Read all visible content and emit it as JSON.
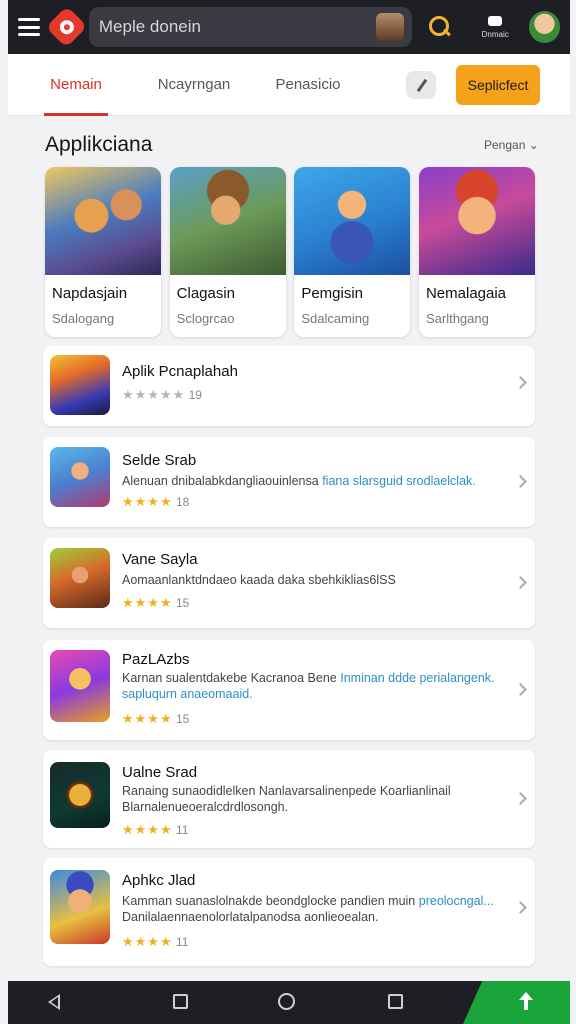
{
  "topbar": {
    "search_text": "Meple donein",
    "profile_label": "Dnmaic"
  },
  "tabs": [
    {
      "label": "Nemain",
      "active": true
    },
    {
      "label": "Ncayrngan",
      "active": false
    },
    {
      "label": "Penasicio",
      "active": false
    }
  ],
  "cta_label": "Seplicfect",
  "section": {
    "title": "Applikciana",
    "sort_label": "Pengan ⌄"
  },
  "featured": [
    {
      "name": "Napdasjain",
      "sub": "Sdalogang",
      "icon": "game-art-warriors"
    },
    {
      "name": "Clagasin",
      "sub": "Sclogrcao",
      "icon": "game-art-cowboy"
    },
    {
      "name": "Pemgisin",
      "sub": "Sdalcaming",
      "icon": "game-art-pirate"
    },
    {
      "name": "Nemalagaia",
      "sub": "Sarlthgang",
      "icon": "game-art-hero"
    }
  ],
  "apps": [
    {
      "title": "Aplik Pcnaplahah",
      "desc": "",
      "desc_hl": "",
      "desc2": "",
      "rating": "19",
      "stars": "★★★★★",
      "grey": true,
      "icon": "game-icon-arcade"
    },
    {
      "title": "Selde Srab",
      "desc": "Alenuan dnibalabkdangliaouinlensa",
      "desc_hl": "fiana slarsguid srodlaelclak.",
      "desc2": "",
      "rating": "18",
      "stars": "★★★★",
      "grey": false,
      "icon": "game-icon-archer"
    },
    {
      "title": "Vane Sayla",
      "desc": "Aomaanlanktdndaeo kaada daka sbehkiklias6lSS",
      "desc_hl": "",
      "desc2": "",
      "rating": "15",
      "stars": "★★★★",
      "grey": false,
      "icon": "game-icon-racer"
    },
    {
      "title": "PazLAzbs",
      "desc": "Karnan sualentdakebe Kacranoa Bene",
      "desc_hl": "Inminan ddde perialangenk.",
      "desc2": "sapluqurn anaeomaaid.",
      "rating": "15",
      "stars": "★★★★",
      "grey": false,
      "icon": "game-icon-royal"
    },
    {
      "title": "Ualne Srad",
      "desc": "Ranaing sunaodidlelken Nanlavarsalinenpede Koarlianlinail",
      "desc_hl": "",
      "desc2": "Blarnalenueoeralcdrdlosongh.",
      "rating": "11",
      "stars": "★★★★",
      "grey": false,
      "icon": "game-icon-emblem"
    },
    {
      "title": "Aphkc Jlad",
      "desc": "Kamman suanaslolnakde beondglocke pandien muin",
      "desc_hl": "preolocngal...",
      "desc2": "Danilalaennaenolorlatalpanodsa aonlieoealan.",
      "rating": "11",
      "stars": "★★★★",
      "grey": false,
      "icon": "game-icon-buddy"
    }
  ]
}
